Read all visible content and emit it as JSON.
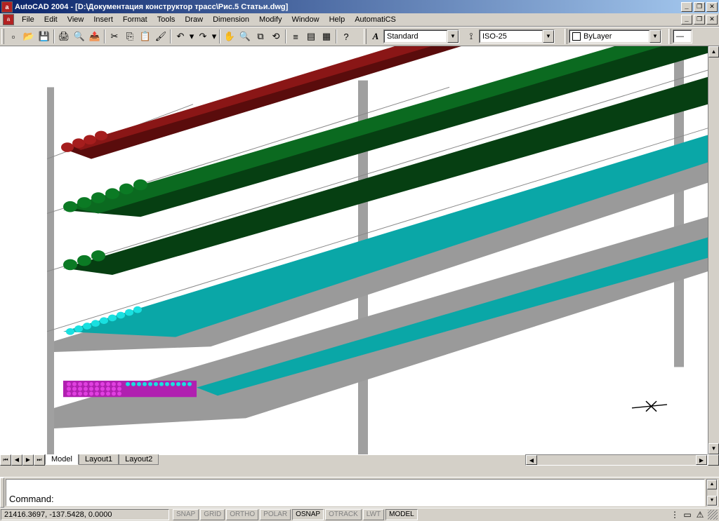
{
  "title": "AutoCAD 2004 - [D:\\Документация конструктор трасс\\Рис.5 Статьи.dwg]",
  "app_icon_letter": "a",
  "menus": [
    "File",
    "Edit",
    "View",
    "Insert",
    "Format",
    "Tools",
    "Draw",
    "Dimension",
    "Modify",
    "Window",
    "Help",
    "AutomatiCS"
  ],
  "doc_icon_letter": "a",
  "toolbar1_icons": [
    "new",
    "open",
    "save",
    "plot",
    "plot-preview",
    "publish",
    "cut",
    "copy",
    "paste",
    "match-prop",
    "undo",
    "redo",
    "pan",
    "zoom-rt",
    "zoom-win",
    "zoom-prev",
    "properties",
    "dc",
    "tool-pal",
    "help"
  ],
  "toolbar2": {
    "style_icon": "A",
    "text_style": "Standard",
    "dim_icon": "dim",
    "dim_style": "ISO-25",
    "layer_color_swatch": "#ffffff",
    "layer_name": "ByLayer"
  },
  "tabs": {
    "active": "Model",
    "items": [
      "Model",
      "Layout1",
      "Layout2"
    ]
  },
  "command_prompt": "Command:",
  "status": {
    "coords": "21416.3697, -137.5428, 0.0000",
    "toggles": [
      {
        "label": "SNAP",
        "on": false
      },
      {
        "label": "GRID",
        "on": false
      },
      {
        "label": "ORTHO",
        "on": false
      },
      {
        "label": "POLAR",
        "on": false
      },
      {
        "label": "OSNAP",
        "on": true
      },
      {
        "label": "OTRACK",
        "on": false
      },
      {
        "label": "LWT",
        "on": false
      },
      {
        "label": "MODEL",
        "on": true
      }
    ]
  },
  "toolbar_glyphs": {
    "new": "▫",
    "open": "📂",
    "save": "💾",
    "plot": "🖨",
    "plot-preview": "🔍",
    "publish": "📤",
    "cut": "✂",
    "copy": "⎘",
    "paste": "📋",
    "match-prop": "🖌",
    "undo": "↶",
    "redo": "↷",
    "pan": "✋",
    "zoom-rt": "🔍",
    "zoom-win": "⧉",
    "zoom-prev": "⟲",
    "properties": "≡",
    "dc": "▤",
    "tool-pal": "▦",
    "help": "?"
  }
}
